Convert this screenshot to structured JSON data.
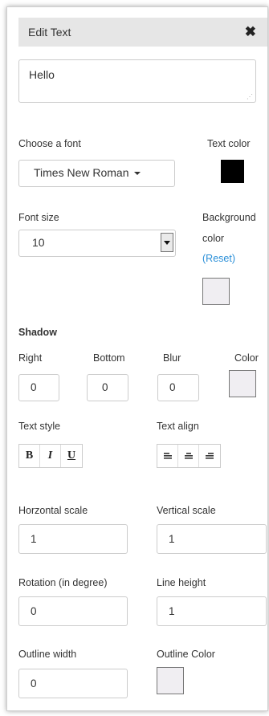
{
  "header": {
    "title": "Edit Text",
    "close_icon": "close-icon"
  },
  "text_input": {
    "value": "Hello"
  },
  "font": {
    "label": "Choose a font",
    "selected": "Times New Roman"
  },
  "text_color": {
    "label": "Text color",
    "color": "#000000"
  },
  "font_size": {
    "label": "Font size",
    "selected": "10"
  },
  "background_color": {
    "label_line1": "Background",
    "label_line2": "color",
    "reset_open": "(",
    "reset_link": "Reset",
    "reset_close": ")",
    "color": "#f0eef2"
  },
  "shadow": {
    "heading": "Shadow",
    "right_label": "Right",
    "right_value": "0",
    "bottom_label": "Bottom",
    "bottom_value": "0",
    "blur_label": "Blur",
    "blur_value": "0",
    "color_label": "Color",
    "color": "#f0eef2"
  },
  "text_style": {
    "label": "Text style",
    "bold": "B",
    "italic": "I",
    "underline": "U"
  },
  "text_align": {
    "label": "Text align",
    "left_icon": "align-left-icon",
    "center_icon": "align-center-icon",
    "right_icon": "align-right-icon"
  },
  "horizontal_scale": {
    "label": "Horzontal scale",
    "value": "1"
  },
  "vertical_scale": {
    "label": "Vertical scale",
    "value": "1"
  },
  "rotation": {
    "label": "Rotation (in degree)",
    "value": "0"
  },
  "line_height": {
    "label": "Line height",
    "value": "1"
  },
  "outline_width": {
    "label": "Outline width",
    "value": "0"
  },
  "outline_color": {
    "label": "Outline Color",
    "color": "#f0eef2"
  }
}
